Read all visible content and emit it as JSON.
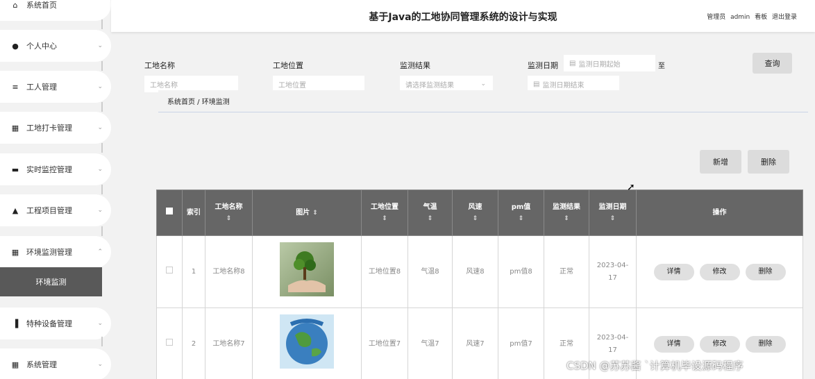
{
  "header": {
    "title": "基于Java的工地协同管理系统的设计与实现",
    "user_text": "管理员 admin  看板  退出登录"
  },
  "sidebar": {
    "items": [
      {
        "label": "系统首页",
        "icon": "home-icon",
        "glyph": "⌂"
      },
      {
        "label": "个人中心",
        "icon": "user-icon",
        "glyph": "●"
      },
      {
        "label": "工人管理",
        "icon": "list-icon",
        "glyph": "≡"
      },
      {
        "label": "工地打卡管理",
        "icon": "grid-icon",
        "glyph": "▦"
      },
      {
        "label": "实时监控管理",
        "icon": "monitor-icon",
        "glyph": "▬"
      },
      {
        "label": "工程项目管理",
        "icon": "folder-icon",
        "glyph": "▲"
      },
      {
        "label": "环境监测管理",
        "icon": "grid-icon",
        "glyph": "▦"
      },
      {
        "label": "特种设备管理",
        "icon": "bar-chart-icon",
        "glyph": "▐"
      },
      {
        "label": "系统管理",
        "icon": "grid-icon",
        "glyph": "▦"
      }
    ],
    "active_sub": "环境监测",
    "chevron_down": "⌄",
    "chevron_up": "⌃"
  },
  "filter": {
    "site_name_label": "工地名称",
    "site_name_placeholder": "工地名称",
    "site_location_label": "工地位置",
    "site_location_placeholder": "工地位置",
    "result_label": "监测结果",
    "result_placeholder": "请选择监测结果",
    "date_label": "监测日期",
    "date_start_placeholder": "监测日期起始",
    "date_to": "至",
    "date_end_placeholder": "监测日期结束",
    "query_button": "查询"
  },
  "breadcrumb": {
    "text": "系统首页 / 环境监测"
  },
  "actions": {
    "add": "新增",
    "delete": "删除"
  },
  "table": {
    "columns": [
      "索引",
      "工地名称",
      "图片",
      "工地位置",
      "气温",
      "风速",
      "pm值",
      "监测结果",
      "监测日期",
      "操作"
    ],
    "sortable": [
      "工地名称",
      "图片",
      "工地位置",
      "气温",
      "风速",
      "pm值",
      "监测结果",
      "监测日期"
    ],
    "rows": [
      {
        "index": "1",
        "site_name": "工地名称8",
        "image": "hand-holding-tree",
        "location": "工地位置8",
        "temp": "气温8",
        "wind": "风速8",
        "pm": "pm值8",
        "result": "正常",
        "date": "2023-04-17"
      },
      {
        "index": "2",
        "site_name": "工地名称7",
        "image": "world-environment-day-globe",
        "location": "工地位置7",
        "temp": "气温7",
        "wind": "风速7",
        "pm": "pm值7",
        "result": "正常",
        "date": "2023-04-17"
      }
    ],
    "row_ops": [
      "详情",
      "修改",
      "删除"
    ]
  },
  "watermark": "CSDN @苏苏酱 `计算机毕设源码程序"
}
